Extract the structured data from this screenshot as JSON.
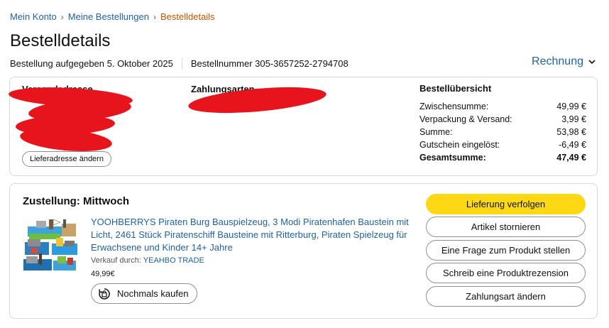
{
  "breadcrumb": {
    "items": [
      "Mein Konto",
      "Meine Bestellungen"
    ],
    "current": "Bestelldetails",
    "separator": "›"
  },
  "page_title": "Bestelldetails",
  "order_meta": {
    "placed": "Bestellung aufgegeben 5. Oktober 2025",
    "number": "Bestellnummer 305-3657252-2794708"
  },
  "invoice": {
    "label": "Rechnung",
    "icon": "chevron-down-icon"
  },
  "shipping_address": {
    "title": "Versandadresse",
    "change_label": "Lieferadresse ändern"
  },
  "payment": {
    "title": "Zahlungsarten"
  },
  "summary": {
    "title": "Bestellübersicht",
    "rows": [
      {
        "label": "Zwischensumme:",
        "value": "49,99 €"
      },
      {
        "label": "Verpackung & Versand:",
        "value": "3,99 €"
      },
      {
        "label": "Summe:",
        "value": "53,98 €"
      },
      {
        "label": "Gutschein eingelöst:",
        "value": "-6,49 €"
      }
    ],
    "total": {
      "label": "Gesamtsumme:",
      "value": "47,49 €"
    }
  },
  "delivery": {
    "title": "Zustellung: Mittwoch",
    "product": {
      "title": "YOOHBERRYS Piraten Burg Bauspielzeug, 3 Modi Piratenhafen Baustein mit Licht, 2461 Stück Piratenschiff Bausteine mit Ritterburg, Piraten Spielzeug für Erwachsene und Kinder 14+ Jahre",
      "seller_prefix": "Verkauf durch:",
      "seller_name": "YEAHBO TRADE",
      "price": "49,99€",
      "buy_again_label": "Nochmals kaufen",
      "image": "pirate-castle-product-image"
    },
    "actions": [
      "Lieferung verfolgen",
      "Artikel stornieren",
      "Eine Frage zum Produkt stellen",
      "Schreib eine Produktrezension",
      "Zahlungsart ändern"
    ]
  },
  "colors": {
    "link": "#2162a1",
    "breadcrumb_current": "#c45500",
    "primary_button": "#ffd814",
    "redaction": "#e8141c",
    "border": "#d5d9d9"
  }
}
